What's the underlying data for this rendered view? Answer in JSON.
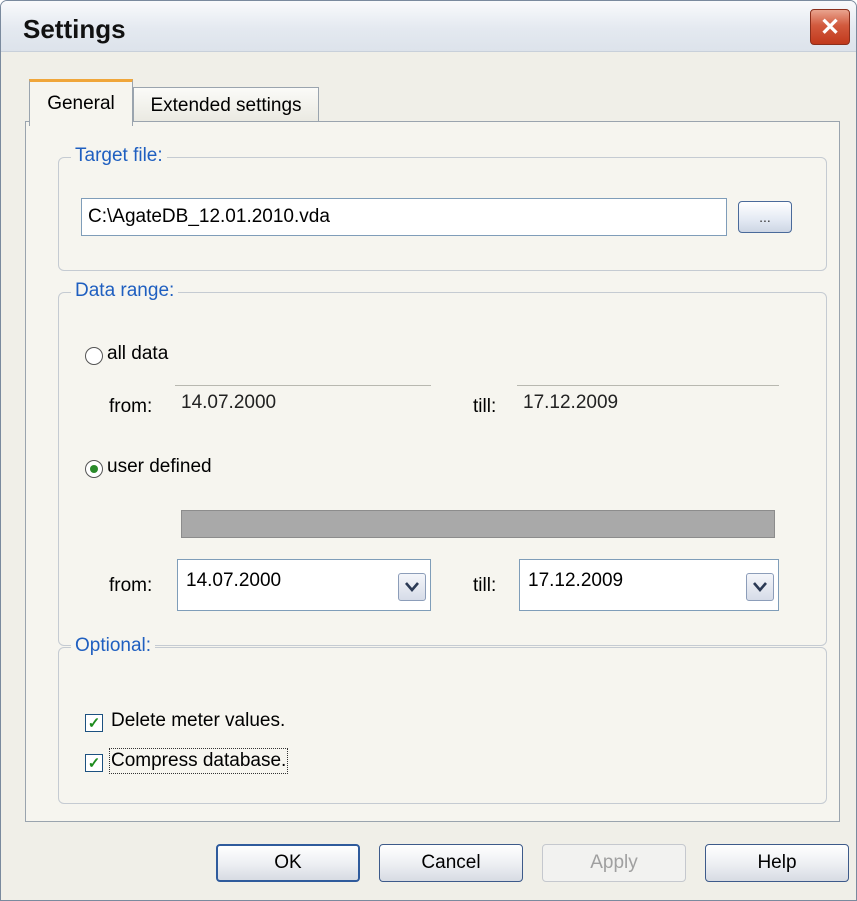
{
  "window": {
    "title": "Settings",
    "close_glyph": "✕"
  },
  "tabs": {
    "general": "General",
    "extended": "Extended settings"
  },
  "target_file": {
    "legend": "Target file:",
    "path": "C:\\AgateDB_12.01.2010.vda",
    "browse_label": "..."
  },
  "data_range": {
    "legend": "Data range:",
    "all_data_label": "all data",
    "all_from_label": "from:",
    "all_from_value": "14.07.2000",
    "all_till_label": "till:",
    "all_till_value": "17.12.2009",
    "user_defined_label": "user defined",
    "user_from_label": "from:",
    "user_from_value": "14.07.2000",
    "user_till_label": "till:",
    "user_till_value": "17.12.2009",
    "selected": "user defined"
  },
  "optional": {
    "legend": "Optional:",
    "delete_meter_label": "Delete meter values.",
    "delete_meter_checked": true,
    "compress_db_label": "Compress database.",
    "compress_db_checked": true
  },
  "buttons": {
    "ok": "OK",
    "cancel": "Cancel",
    "apply": "Apply",
    "help": "Help"
  },
  "colors": {
    "legend_text": "#1f5fc0",
    "close_button": "#c1391c",
    "check_mark": "#1e8c1e",
    "tab_highlight": "#f0a63a"
  }
}
